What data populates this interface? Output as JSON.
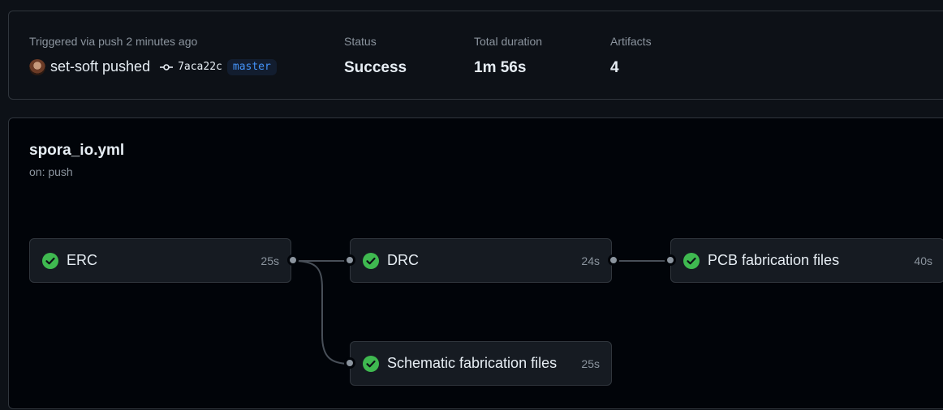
{
  "summary": {
    "trigger_label": "Triggered via push 2 minutes ago",
    "pusher": "set-soft pushed",
    "commit_sha": "7aca22c",
    "branch": "master",
    "status_label": "Status",
    "status_value": "Success",
    "duration_label": "Total duration",
    "duration_value": "1m 56s",
    "artifacts_label": "Artifacts",
    "artifacts_value": "4"
  },
  "workflow": {
    "file": "spora_io.yml",
    "trigger": "on: push"
  },
  "jobs": [
    {
      "name": "ERC",
      "duration": "25s",
      "status": "success"
    },
    {
      "name": "DRC",
      "duration": "24s",
      "status": "success"
    },
    {
      "name": "PCB fabrication files",
      "duration": "40s",
      "status": "success"
    },
    {
      "name": "Schematic fabrication files",
      "duration": "25s",
      "status": "success"
    }
  ],
  "colors": {
    "success": "#3fb950",
    "link": "#4493f8",
    "muted": "#8b949e",
    "border": "#30363d",
    "bg": "#0d1117"
  },
  "icons": {
    "job_status": "check-circle-fill-icon",
    "commit": "git-commit-icon"
  }
}
